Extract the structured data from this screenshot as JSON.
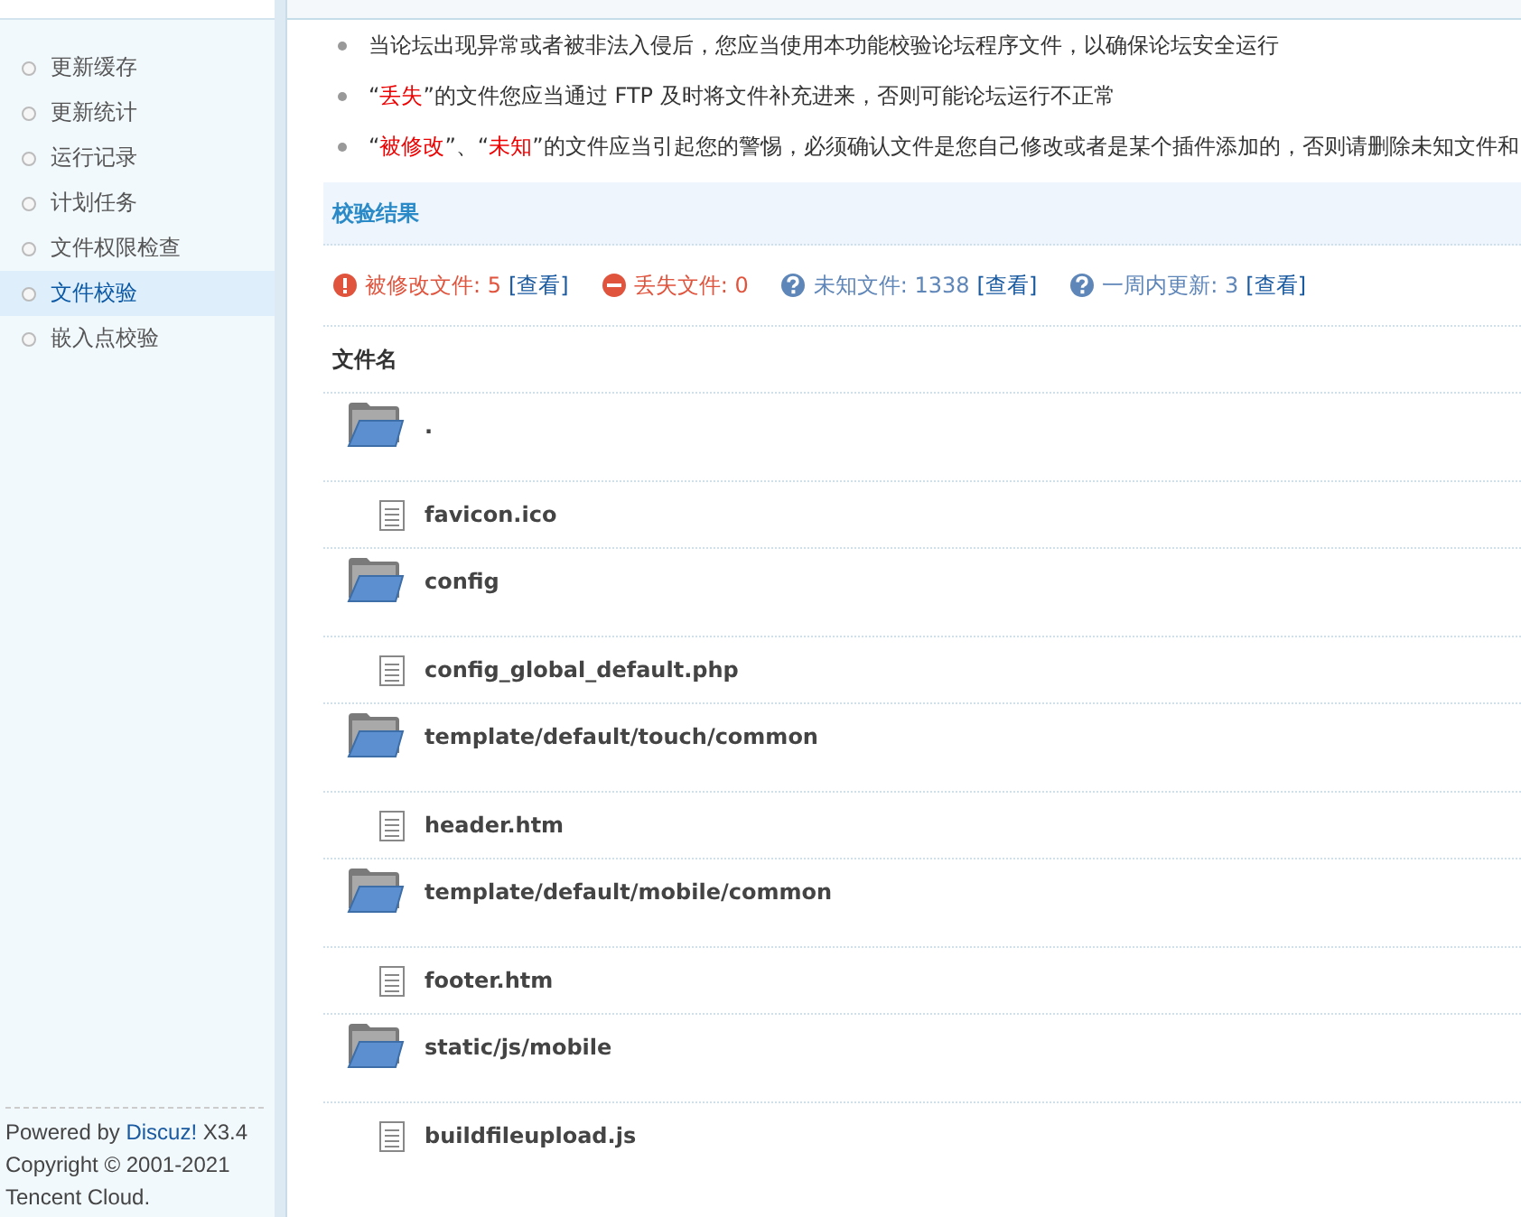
{
  "sidebar": {
    "items": [
      {
        "label": "更新缓存",
        "selected": false
      },
      {
        "label": "更新统计",
        "selected": false
      },
      {
        "label": "运行记录",
        "selected": false
      },
      {
        "label": "计划任务",
        "selected": false
      },
      {
        "label": "文件权限检查",
        "selected": false
      },
      {
        "label": "文件校验",
        "selected": true
      },
      {
        "label": "嵌入点校验",
        "selected": false
      }
    ],
    "footer": {
      "before": "Powered by ",
      "link": "Discuz!",
      "after": " X3.4",
      "lines": [
        "Copyright © 2001-2021",
        "Tencent Cloud."
      ]
    }
  },
  "notes": [
    [
      {
        "text": "当论坛出现异常或者被非法入侵后，您应当使用本功能校验论坛程序文件，以确保论坛安全运行",
        "kind": "normal"
      }
    ],
    [
      {
        "text": "“",
        "kind": "normal"
      },
      {
        "text": "丢失",
        "kind": "warn"
      },
      {
        "text": "”的文件您应当通过 FTP 及时将文件补充进来，否则可能论坛运行不正常",
        "kind": "normal"
      }
    ],
    [
      {
        "text": "“",
        "kind": "normal"
      },
      {
        "text": "被修改",
        "kind": "warn"
      },
      {
        "text": "”、“",
        "kind": "normal"
      },
      {
        "text": "未知",
        "kind": "warn"
      },
      {
        "text": "”的文件应当引起您的警惕，必须确认文件是您自己修改或者是某个插件添加的，否则请删除未知文件和",
        "kind": "normal"
      }
    ]
  ],
  "results": {
    "title": "校验结果",
    "stats": [
      {
        "kind": "modified",
        "label": "被修改文件: 5",
        "link": "[查看]"
      },
      {
        "kind": "missing",
        "label": "丢失文件: 0"
      },
      {
        "kind": "unknown",
        "label": "未知文件: 1338",
        "link": "[查看]"
      },
      {
        "kind": "unknown",
        "label": "一周内更新: 3",
        "link": "[查看]"
      }
    ],
    "column": "文件名",
    "rows": [
      {
        "kind": "folder",
        "name": "."
      },
      {
        "kind": "file",
        "name": "favicon.ico"
      },
      {
        "kind": "folder",
        "name": "config"
      },
      {
        "kind": "file",
        "name": "config_global_default.php"
      },
      {
        "kind": "folder",
        "name": "template/default/touch/common"
      },
      {
        "kind": "file",
        "name": "header.htm"
      },
      {
        "kind": "folder",
        "name": "template/default/mobile/common"
      },
      {
        "kind": "file",
        "name": "footer.htm"
      },
      {
        "kind": "folder",
        "name": "static/js/mobile"
      },
      {
        "kind": "file",
        "name": "buildfileupload.js"
      }
    ]
  }
}
